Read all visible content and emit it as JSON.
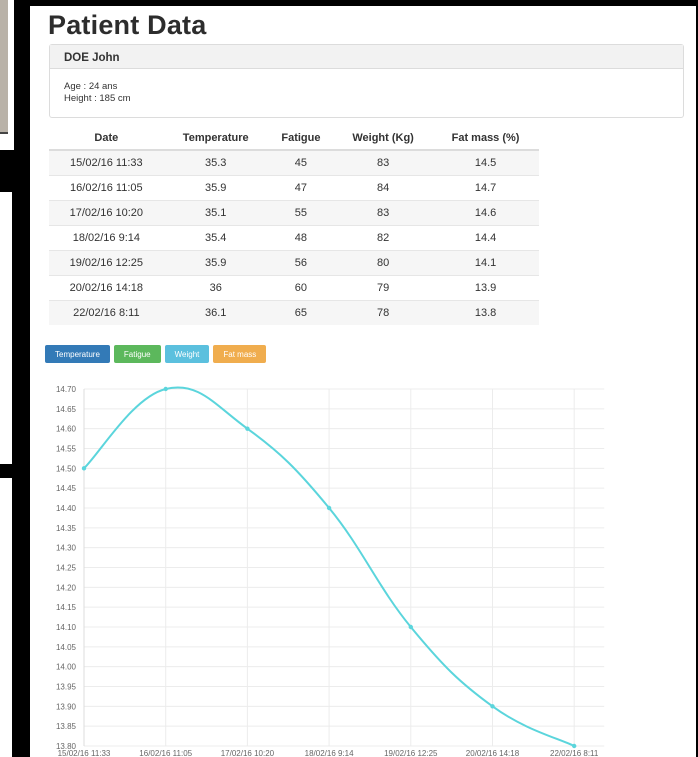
{
  "page": {
    "title": "Patient Data",
    "patient": {
      "name": "DOE John",
      "age": "Age : 24 ans",
      "height": "Height : 185 cm"
    }
  },
  "table": {
    "headers": [
      "Date",
      "Temperature",
      "Fatigue",
      "Weight (Kg)",
      "Fat mass (%)"
    ],
    "rows": [
      [
        "15/02/16 11:33",
        "35.3",
        "45",
        "83",
        "14.5"
      ],
      [
        "16/02/16 11:05",
        "35.9",
        "47",
        "84",
        "14.7"
      ],
      [
        "17/02/16 10:20",
        "35.1",
        "55",
        "83",
        "14.6"
      ],
      [
        "18/02/16 9:14",
        "35.4",
        "48",
        "82",
        "14.4"
      ],
      [
        "19/02/16 12:25",
        "35.9",
        "56",
        "80",
        "14.1"
      ],
      [
        "20/02/16 14:18",
        "36",
        "60",
        "79",
        "13.9"
      ],
      [
        "22/02/16 8:11",
        "36.1",
        "65",
        "78",
        "13.8"
      ]
    ]
  },
  "buttons": [
    {
      "label": "Temperature",
      "color": "#337ab7"
    },
    {
      "label": "Fatigue",
      "color": "#5cb85c"
    },
    {
      "label": "Weight",
      "color": "#5bc0de"
    },
    {
      "label": "Fat mass",
      "color": "#f0ad4e"
    }
  ],
  "chart_data": {
    "type": "line",
    "x": [
      "15/02/16 11:33",
      "16/02/16 11:05",
      "17/02/16 10:20",
      "18/02/16 9:14",
      "19/02/16 12:25",
      "20/02/16 14:18",
      "22/02/16 8:11"
    ],
    "series": [
      {
        "values": [
          14.5,
          14.7,
          14.6,
          14.4,
          14.1,
          13.9,
          13.8
        ],
        "color": "#5bd5dc"
      }
    ],
    "ylim": [
      13.8,
      14.7
    ],
    "yticks": [
      "14.70",
      "14.65",
      "14.60",
      "14.55",
      "14.50",
      "14.45",
      "14.40",
      "14.35",
      "14.30",
      "14.25",
      "14.20",
      "14.15",
      "14.10",
      "14.05",
      "14.00",
      "13.95",
      "13.90",
      "13.85",
      "13.80"
    ],
    "grid": true,
    "legend": "none"
  }
}
